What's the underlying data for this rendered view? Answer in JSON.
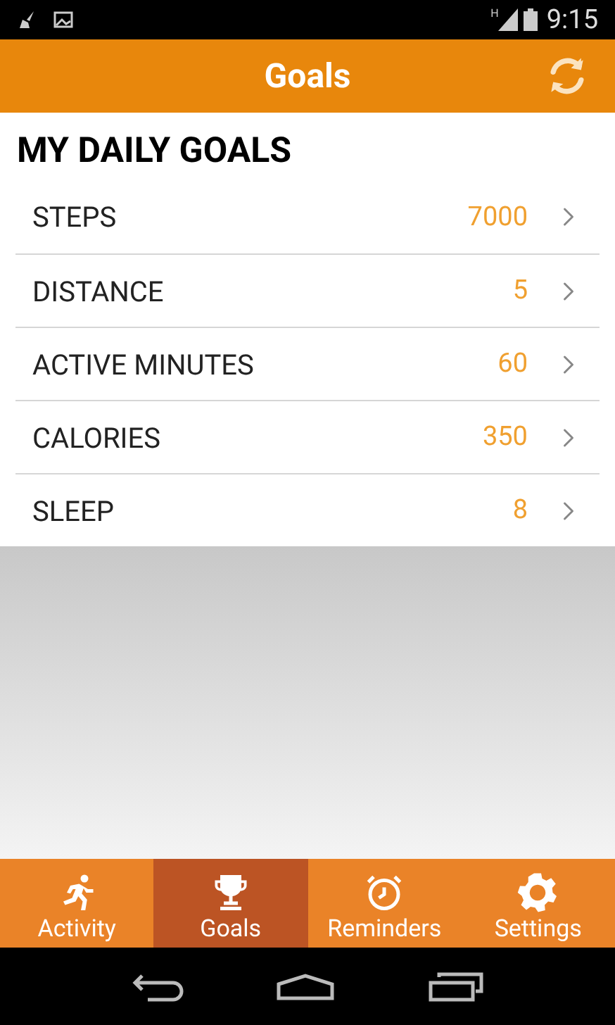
{
  "status_bar": {
    "network": "H",
    "time": "9:15"
  },
  "header": {
    "title": "Goals"
  },
  "section_title": "MY DAILY GOALS",
  "goals": [
    {
      "label": "STEPS",
      "value": "7000"
    },
    {
      "label": "DISTANCE",
      "value": "5"
    },
    {
      "label": "ACTIVE MINUTES",
      "value": "60"
    },
    {
      "label": "CALORIES",
      "value": "350"
    },
    {
      "label": "SLEEP",
      "value": "8"
    }
  ],
  "tabs": [
    {
      "label": "Activity",
      "selected": false
    },
    {
      "label": "Goals",
      "selected": true
    },
    {
      "label": "Reminders",
      "selected": false
    },
    {
      "label": "Settings",
      "selected": false
    }
  ]
}
